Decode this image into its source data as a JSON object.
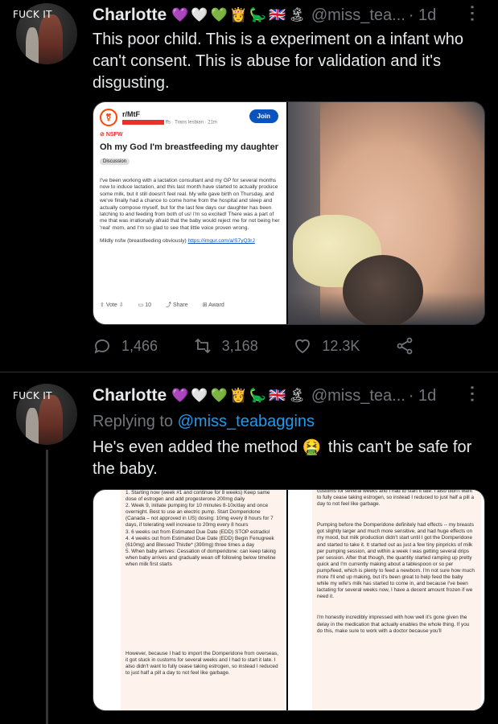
{
  "tweets": [
    {
      "avatar_text": "FUCK IT",
      "name": "Charlotte",
      "name_emoji": [
        "💜",
        "🤍",
        "💚",
        "👸",
        "🦕",
        "🇬🇧",
        "🏝"
      ],
      "handle": "@miss_tea...",
      "time": "· 1d",
      "text": "This poor child. This is a experiment on a infant who can't consent. This is abuse for validation and it's disgusting.",
      "stats": {
        "replies": "1,466",
        "retweets": "3,168",
        "likes": "12.3K"
      }
    },
    {
      "avatar_text": "FUCK IT",
      "name": "Charlotte",
      "name_emoji": [
        "💜",
        "🤍",
        "💚",
        "👸",
        "🦕",
        "🇬🇧",
        "🏝"
      ],
      "handle": "@miss_tea...",
      "time": "· 1d",
      "replying_prefix": "Replying to",
      "replying_to": "@miss_teabaggins",
      "text_before": "He's even added the method",
      "text_emoji": "🤮",
      "text_after": "this can't be safe for the baby."
    }
  ],
  "reddit_card": {
    "subreddit": "r/MtF",
    "meta": "ffs · Trans lesbian · 21m",
    "join_label": "Join",
    "nsfw_label": "NSFW",
    "title": "Oh my God I'm breastfeeding my daughter",
    "flair": "Discussion",
    "body": "I've been working with a lactation consultant and my GP for several months now to induce lactation, and this last month have started to actually produce some milk, but it still doesn't feel real. My wife gave birth on Thursday, and we've finally had a chance to come home from the hospital and sleep and actually compose myself, but for the last few days our daughter has been latching to and feeding from both of us! I'm so excited! There was a part of me that was irrationally afraid that the baby would reject me for not being her 'real' mom, and I'm so glad to see that little voice proven wrong.",
    "footer_text": "Mildly nsfw (breastfeeding obviously)",
    "footer_link": "https://imgur.com/a/S7yQ3rJ",
    "vote_label": "Vote",
    "comments_count": "10",
    "share_label": "Share",
    "award_label": "Award"
  },
  "doc_left": {
    "paragraphs": [
      "1. Starting now (week #1 and continue for 8 weeks) Keep same dose of estrogen and add progesterone 200mg daily\n2. Week 9, initiate pumping for 10 minutes 8-10x/day and once overnight. Best to use an electric pump. Start Domperidone (Canada – not approved in US) dosing: 10mg every 8 hours for 7 days, if tolerating well increase to 20mg every 8 hours\n3. 6 weeks out from Estimated Due Date (EDD) STOP estradiol\n4. 4 weeks out from Estimated Due Date (EDD) Begin Fenugreek (610mg) and Blessed Thistle* (390mg) three times a day\n5. When baby arrives: Cessation of domperidone: can keep taking when baby arrives and gradually wean off following below timeline when milk first starts",
      "However, because I had to import the Domperidone from overseas, it got stuck in customs for several weeks and I had to start it late. I also didn't want to fully cease taking estrogen, so instead I reduced to just half a pill a day to not feel like garbage."
    ]
  },
  "doc_right": {
    "paragraphs": [
      "customs for several weeks and I had to start it late. I also didn't want to fully cease taking estrogen, so instead I reduced to just half a pill a day to not feel like garbage.",
      "Pumping before the Domperidone definitely had effects -- my breasts got slightly larger and much more sensitive, and had huge effects on my mood, but milk production didn't start until I got the Domperidone and started to take it. It started out as just a few tiny pinpricks of milk per pumping session, and within a week I was getting several drips per session. After that though, the quantity started ramping up pretty quick and I'm currently making about a tablespoon or so per pump/feed, which is plenty to feed a newborn. I'm not sure how much more I'll end up making, but it's been great to help feed the baby while my wife's milk has started to come in, and because I've been lactating for several weeks now, I have a decent amount frozen if we need it.",
      "I'm honestly incredibly impressed with how well it's gone given the delay in the medication that actually enables the whole thing. If you do this, make sure to work with a doctor because you'll"
    ]
  }
}
